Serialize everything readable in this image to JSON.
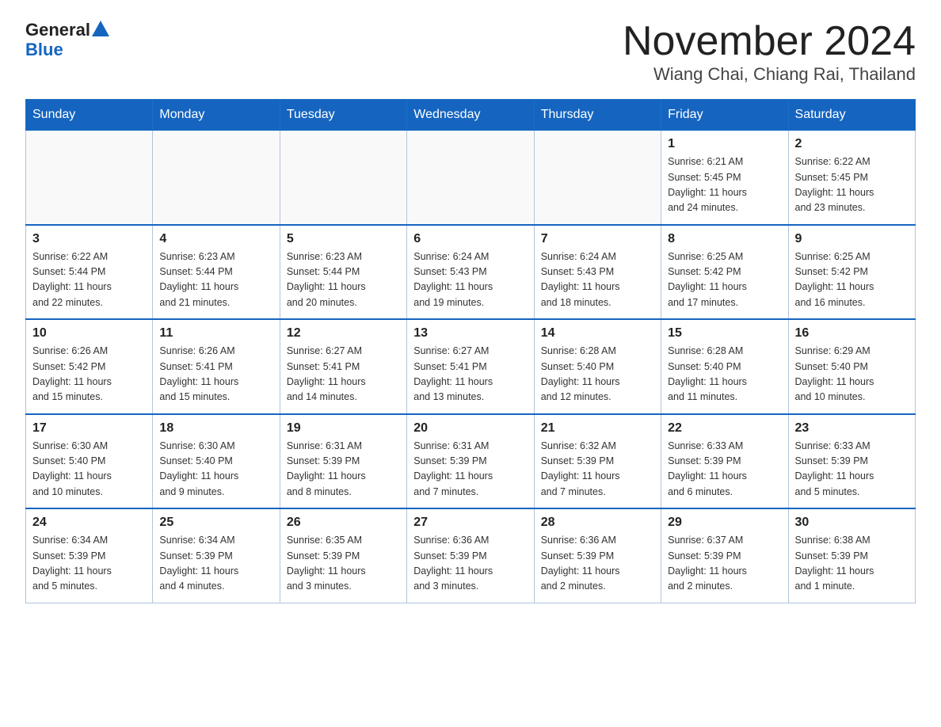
{
  "header": {
    "logo_general": "General",
    "logo_blue": "Blue",
    "title": "November 2024",
    "subtitle": "Wiang Chai, Chiang Rai, Thailand"
  },
  "weekdays": [
    "Sunday",
    "Monday",
    "Tuesday",
    "Wednesday",
    "Thursday",
    "Friday",
    "Saturday"
  ],
  "weeks": [
    [
      {
        "day": "",
        "info": ""
      },
      {
        "day": "",
        "info": ""
      },
      {
        "day": "",
        "info": ""
      },
      {
        "day": "",
        "info": ""
      },
      {
        "day": "",
        "info": ""
      },
      {
        "day": "1",
        "info": "Sunrise: 6:21 AM\nSunset: 5:45 PM\nDaylight: 11 hours\nand 24 minutes."
      },
      {
        "day": "2",
        "info": "Sunrise: 6:22 AM\nSunset: 5:45 PM\nDaylight: 11 hours\nand 23 minutes."
      }
    ],
    [
      {
        "day": "3",
        "info": "Sunrise: 6:22 AM\nSunset: 5:44 PM\nDaylight: 11 hours\nand 22 minutes."
      },
      {
        "day": "4",
        "info": "Sunrise: 6:23 AM\nSunset: 5:44 PM\nDaylight: 11 hours\nand 21 minutes."
      },
      {
        "day": "5",
        "info": "Sunrise: 6:23 AM\nSunset: 5:44 PM\nDaylight: 11 hours\nand 20 minutes."
      },
      {
        "day": "6",
        "info": "Sunrise: 6:24 AM\nSunset: 5:43 PM\nDaylight: 11 hours\nand 19 minutes."
      },
      {
        "day": "7",
        "info": "Sunrise: 6:24 AM\nSunset: 5:43 PM\nDaylight: 11 hours\nand 18 minutes."
      },
      {
        "day": "8",
        "info": "Sunrise: 6:25 AM\nSunset: 5:42 PM\nDaylight: 11 hours\nand 17 minutes."
      },
      {
        "day": "9",
        "info": "Sunrise: 6:25 AM\nSunset: 5:42 PM\nDaylight: 11 hours\nand 16 minutes."
      }
    ],
    [
      {
        "day": "10",
        "info": "Sunrise: 6:26 AM\nSunset: 5:42 PM\nDaylight: 11 hours\nand 15 minutes."
      },
      {
        "day": "11",
        "info": "Sunrise: 6:26 AM\nSunset: 5:41 PM\nDaylight: 11 hours\nand 15 minutes."
      },
      {
        "day": "12",
        "info": "Sunrise: 6:27 AM\nSunset: 5:41 PM\nDaylight: 11 hours\nand 14 minutes."
      },
      {
        "day": "13",
        "info": "Sunrise: 6:27 AM\nSunset: 5:41 PM\nDaylight: 11 hours\nand 13 minutes."
      },
      {
        "day": "14",
        "info": "Sunrise: 6:28 AM\nSunset: 5:40 PM\nDaylight: 11 hours\nand 12 minutes."
      },
      {
        "day": "15",
        "info": "Sunrise: 6:28 AM\nSunset: 5:40 PM\nDaylight: 11 hours\nand 11 minutes."
      },
      {
        "day": "16",
        "info": "Sunrise: 6:29 AM\nSunset: 5:40 PM\nDaylight: 11 hours\nand 10 minutes."
      }
    ],
    [
      {
        "day": "17",
        "info": "Sunrise: 6:30 AM\nSunset: 5:40 PM\nDaylight: 11 hours\nand 10 minutes."
      },
      {
        "day": "18",
        "info": "Sunrise: 6:30 AM\nSunset: 5:40 PM\nDaylight: 11 hours\nand 9 minutes."
      },
      {
        "day": "19",
        "info": "Sunrise: 6:31 AM\nSunset: 5:39 PM\nDaylight: 11 hours\nand 8 minutes."
      },
      {
        "day": "20",
        "info": "Sunrise: 6:31 AM\nSunset: 5:39 PM\nDaylight: 11 hours\nand 7 minutes."
      },
      {
        "day": "21",
        "info": "Sunrise: 6:32 AM\nSunset: 5:39 PM\nDaylight: 11 hours\nand 7 minutes."
      },
      {
        "day": "22",
        "info": "Sunrise: 6:33 AM\nSunset: 5:39 PM\nDaylight: 11 hours\nand 6 minutes."
      },
      {
        "day": "23",
        "info": "Sunrise: 6:33 AM\nSunset: 5:39 PM\nDaylight: 11 hours\nand 5 minutes."
      }
    ],
    [
      {
        "day": "24",
        "info": "Sunrise: 6:34 AM\nSunset: 5:39 PM\nDaylight: 11 hours\nand 5 minutes."
      },
      {
        "day": "25",
        "info": "Sunrise: 6:34 AM\nSunset: 5:39 PM\nDaylight: 11 hours\nand 4 minutes."
      },
      {
        "day": "26",
        "info": "Sunrise: 6:35 AM\nSunset: 5:39 PM\nDaylight: 11 hours\nand 3 minutes."
      },
      {
        "day": "27",
        "info": "Sunrise: 6:36 AM\nSunset: 5:39 PM\nDaylight: 11 hours\nand 3 minutes."
      },
      {
        "day": "28",
        "info": "Sunrise: 6:36 AM\nSunset: 5:39 PM\nDaylight: 11 hours\nand 2 minutes."
      },
      {
        "day": "29",
        "info": "Sunrise: 6:37 AM\nSunset: 5:39 PM\nDaylight: 11 hours\nand 2 minutes."
      },
      {
        "day": "30",
        "info": "Sunrise: 6:38 AM\nSunset: 5:39 PM\nDaylight: 11 hours\nand 1 minute."
      }
    ]
  ]
}
